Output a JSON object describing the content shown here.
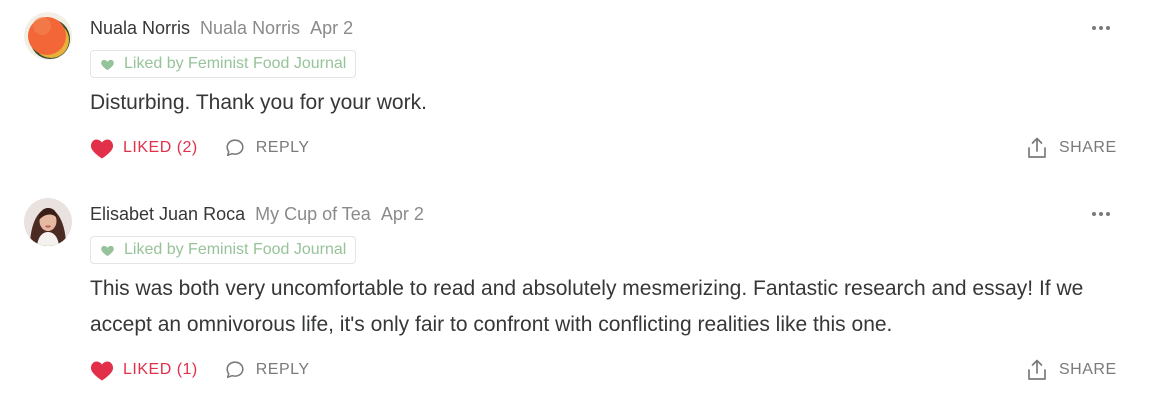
{
  "colors": {
    "like_red": "#e2304a",
    "badge_green": "#97c39a",
    "text": "#363737",
    "muted": "#8a8a8a"
  },
  "comments": [
    {
      "author": "Nuala Norris",
      "publication": "Nuala Norris",
      "date": "Apr 2",
      "liked_badge": "Liked by Feminist Food Journal",
      "text": "Disturbing. Thank you for your work.",
      "like_label": "LIKED (2)",
      "reply_label": "REPLY",
      "share_label": "SHARE",
      "avatar_icon": "abstract-orange-avatar",
      "more_icon": "more-horizontal-icon"
    },
    {
      "author": "Elisabet Juan Roca",
      "publication": "My Cup of Tea",
      "date": "Apr 2",
      "liked_badge": "Liked by Feminist Food Journal",
      "text": "This was both very uncomfortable to read and absolutely mesmerizing. Fantastic research and essay! If we accept an omnivorous life, it's only fair to confront with conflicting realities like this one.",
      "like_label": "LIKED (1)",
      "reply_label": "REPLY",
      "share_label": "SHARE",
      "avatar_icon": "portrait-photo-avatar",
      "more_icon": "more-horizontal-icon"
    }
  ]
}
